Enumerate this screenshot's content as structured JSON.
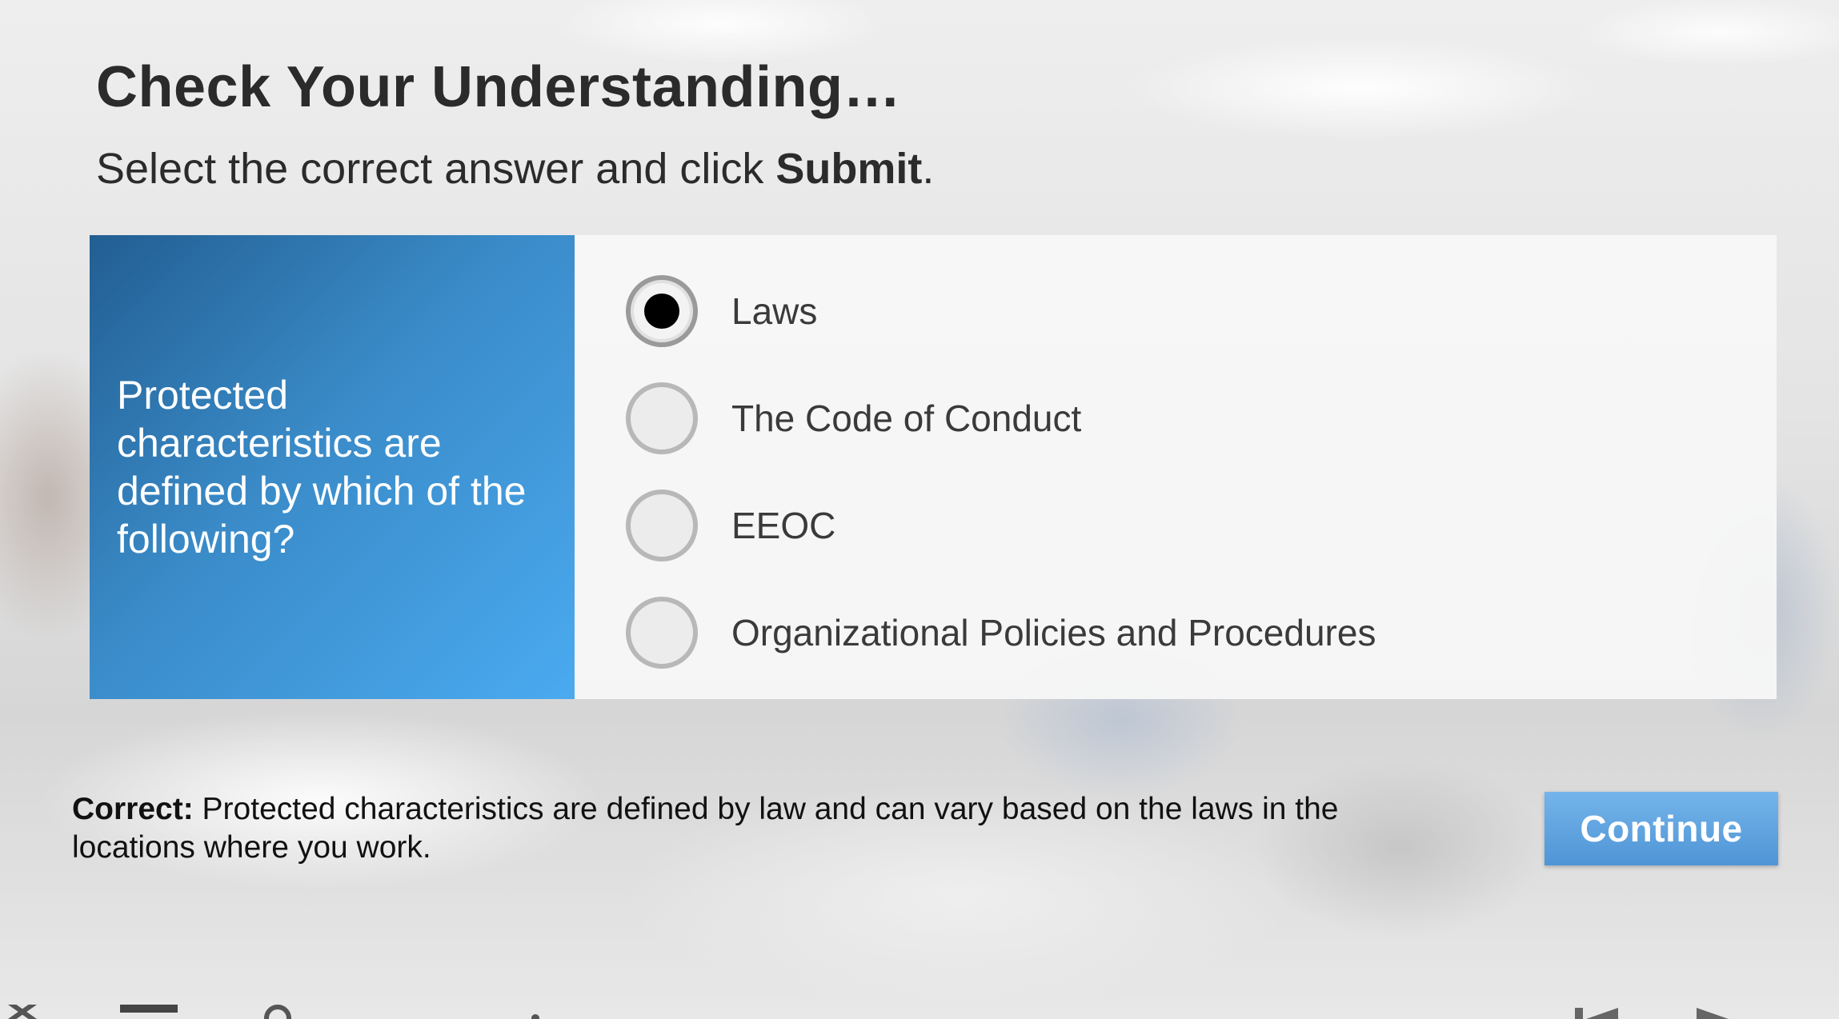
{
  "header": {
    "title": "Check Your Understanding…",
    "instruction_prefix": "Select the correct answer and click ",
    "instruction_bold": "Submit",
    "instruction_suffix": "."
  },
  "question": {
    "text": "Protected characteristics are defined by which of the following?"
  },
  "answers": [
    {
      "label": "Laws",
      "selected": true
    },
    {
      "label": "The Code of Conduct",
      "selected": false
    },
    {
      "label": "EEOC",
      "selected": false
    },
    {
      "label": "Organizational Policies and Procedures",
      "selected": false
    }
  ],
  "feedback": {
    "prefix": "Correct:",
    "text": " Protected characteristics are defined by law and can vary based on the laws in the locations where you work."
  },
  "buttons": {
    "continue_label": "Continue"
  },
  "player_controls": [
    {
      "icon": "close-icon"
    },
    {
      "icon": "menu-icon"
    },
    {
      "icon": "pin-icon"
    },
    {
      "icon": "dot-icon"
    },
    {
      "icon": "previous-icon"
    },
    {
      "icon": "next-icon"
    }
  ],
  "colors": {
    "question_panel_start": "#225e92",
    "question_panel_end": "#4aaaf0",
    "button": "#5a9fdd",
    "text_dark": "#2b2b2b"
  }
}
